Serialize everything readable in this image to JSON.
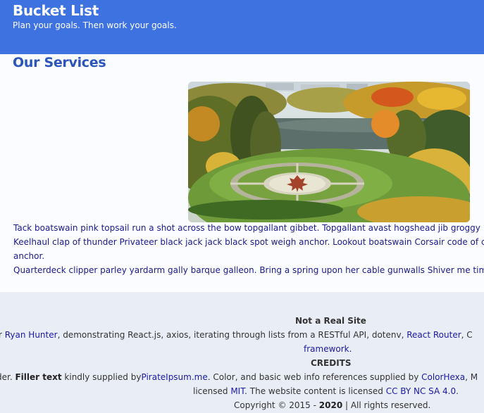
{
  "header": {
    "title": "Bucket List",
    "tagline": "Plan your goals. Then work your goals."
  },
  "services": {
    "heading": "Our Services",
    "paragraphs": [
      "Tack boatswain pink topsail run a shot across the bow topgallant gibbet. Topgallant avast hogshead jib groggy",
      "Keelhaul clap of thunder Privateer black jack jack black spot weigh anchor. Lookout boatswain Corsair code of conduct",
      "anchor.",
      "Quarterdeck clipper parley yardarm gally barque galleon. Bring a spring upon her cable gunwalls Shiver me timbers"
    ]
  },
  "footer": {
    "site_title": "Not a Real Site",
    "line1": {
      "pre": "r ",
      "author_link": "Ryan Hunter",
      "mid": ", demonstrating React.js, axios, iterating through lists from a RESTful API, dotenv, ",
      "router_link": "React Router",
      "post": ", C"
    },
    "framework": "framework.",
    "credits_heading": "CREDITS",
    "line2": {
      "pre": "der. ",
      "filler_bold": "Filler text",
      "mid": " kindly supplied by",
      "pirate_link": "PirateIpsum.me",
      "mid2": ". Color, and basic web info references supplied by ",
      "colorhexa_link": "ColorHexa",
      "post": ", M"
    },
    "line3": {
      "pre": "licensed ",
      "mit_link": "MIT",
      "mid": ". The website content is licensed ",
      "cc_link": "CC BY NC SA 4.0",
      "post": "."
    },
    "copyright": {
      "pre": "Copyright © 2015 - ",
      "year_bold": "2020",
      "post": " | All rights reserved."
    }
  }
}
